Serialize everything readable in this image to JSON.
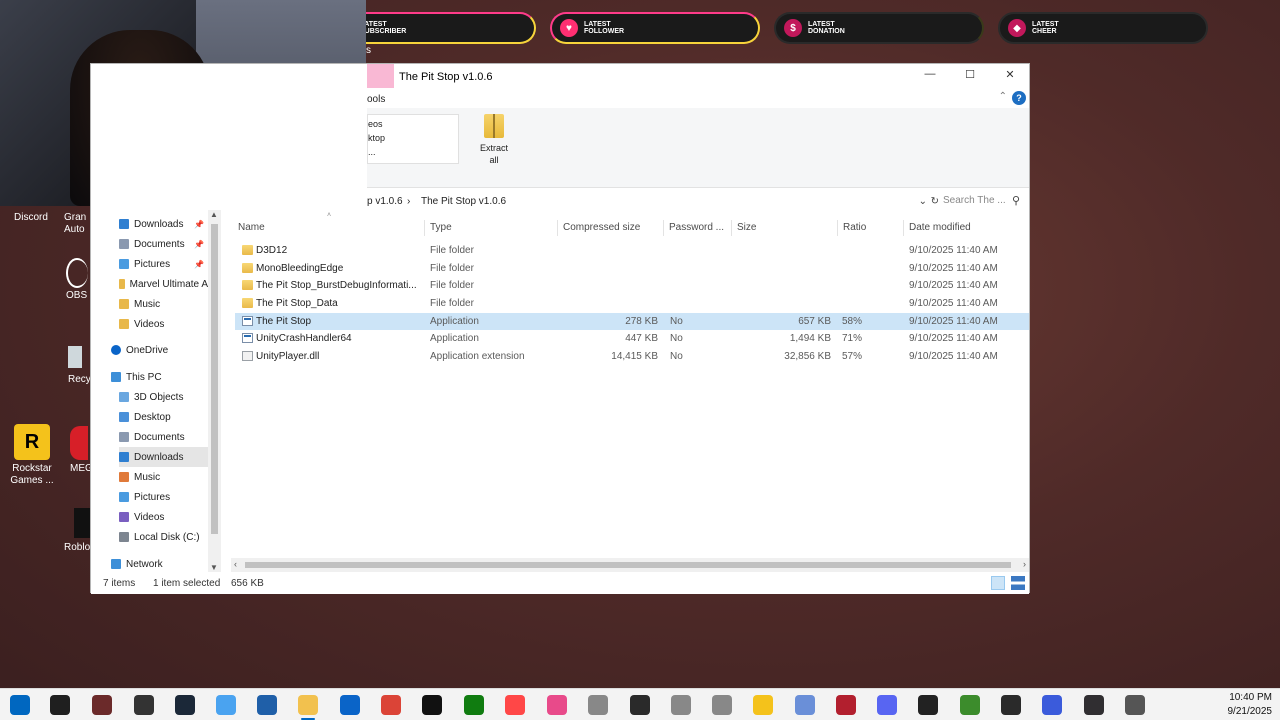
{
  "overlay": {
    "alerts": [
      {
        "line1": "LATEST",
        "line2": "SUBSCRIBER"
      },
      {
        "line1": "LATEST",
        "line2": "FOLLOWER"
      },
      {
        "line1": "LATEST",
        "line2": "DONATION"
      },
      {
        "line1": "LATEST",
        "line2": "CHEER"
      }
    ]
  },
  "desktop": {
    "icons": [
      {
        "label": "Discord"
      },
      {
        "label": "Gran Auto"
      },
      {
        "label": "OBS"
      },
      {
        "label": "Recy"
      },
      {
        "label": "Rockstar Games ..."
      },
      {
        "label": "MEG"
      },
      {
        "label": "Roblo"
      }
    ],
    "edge_text": "s"
  },
  "window": {
    "title": "The Pit Stop v1.0.6",
    "ribbon_tab": "ools",
    "ribbon_list": [
      "eos",
      "ktop",
      "..."
    ],
    "extract_label": "Extract all",
    "breadcrumb": [
      "p v1.0.6",
      "The Pit Stop v1.0.6"
    ],
    "search_placeholder": "Search The ...",
    "nav": {
      "items": [
        {
          "label": "Downloads",
          "pinned": true,
          "color": "#2f7fd1"
        },
        {
          "label": "Documents",
          "pinned": true,
          "color": "#8a99b0"
        },
        {
          "label": "Pictures",
          "pinned": true,
          "color": "#4a9be0"
        },
        {
          "label": "Marvel Ultimate A",
          "pinned": false,
          "color": "#e8b84a"
        },
        {
          "label": "Music",
          "pinned": false,
          "color": "#e8b84a"
        },
        {
          "label": "Videos",
          "pinned": false,
          "color": "#e8b84a"
        },
        {
          "label": "OneDrive",
          "pinned": false,
          "color": "#0a64c8"
        },
        {
          "label": "This PC",
          "pinned": false,
          "color": "#3d8fd8"
        },
        {
          "label": "3D Objects",
          "pinned": false,
          "color": "#6aa7e0"
        },
        {
          "label": "Desktop",
          "pinned": false,
          "color": "#4a90d9"
        },
        {
          "label": "Documents",
          "pinned": false,
          "color": "#8a99b0"
        },
        {
          "label": "Downloads",
          "pinned": false,
          "color": "#2f7fd1"
        },
        {
          "label": "Music",
          "pinned": false,
          "color": "#e07a3a"
        },
        {
          "label": "Pictures",
          "pinned": false,
          "color": "#4a9be0"
        },
        {
          "label": "Videos",
          "pinned": false,
          "color": "#7a5fc0"
        },
        {
          "label": "Local Disk (C:)",
          "pinned": false,
          "color": "#7d8590"
        },
        {
          "label": "Network",
          "pinned": false,
          "color": "#3d8fd8"
        }
      ]
    },
    "columns": [
      "Name",
      "Type",
      "Compressed size",
      "Password ...",
      "Size",
      "Ratio",
      "Date modified"
    ],
    "files": [
      {
        "name": "D3D12",
        "type": "File folder",
        "compressed": "",
        "password": "",
        "size": "",
        "ratio": "",
        "date": "9/10/2025 11:40 AM",
        "kind": "folder"
      },
      {
        "name": "MonoBleedingEdge",
        "type": "File folder",
        "compressed": "",
        "password": "",
        "size": "",
        "ratio": "",
        "date": "9/10/2025 11:40 AM",
        "kind": "folder"
      },
      {
        "name": "The Pit Stop_BurstDebugInformati...",
        "type": "File folder",
        "compressed": "",
        "password": "",
        "size": "",
        "ratio": "",
        "date": "9/10/2025 11:40 AM",
        "kind": "folder"
      },
      {
        "name": "The Pit Stop_Data",
        "type": "File folder",
        "compressed": "",
        "password": "",
        "size": "",
        "ratio": "",
        "date": "9/10/2025 11:40 AM",
        "kind": "folder"
      },
      {
        "name": "The Pit Stop",
        "type": "Application",
        "compressed": "278 KB",
        "password": "No",
        "size": "657 KB",
        "ratio": "58%",
        "date": "9/10/2025 11:40 AM",
        "kind": "app",
        "selected": true
      },
      {
        "name": "UnityCrashHandler64",
        "type": "Application",
        "compressed": "447 KB",
        "password": "No",
        "size": "1,494 KB",
        "ratio": "71%",
        "date": "9/10/2025 11:40 AM",
        "kind": "app"
      },
      {
        "name": "UnityPlayer.dll",
        "type": "Application extension",
        "compressed": "14,415 KB",
        "password": "No",
        "size": "32,856 KB",
        "ratio": "57%",
        "date": "9/10/2025 11:40 AM",
        "kind": "dll"
      }
    ],
    "status": {
      "count": "7 items",
      "selection": "1 item selected",
      "selection_size": "656 KB"
    }
  },
  "taskbar": {
    "icons": [
      {
        "name": "start-icon",
        "color": "#0067c0"
      },
      {
        "name": "search-icon",
        "color": "#1f1f1f"
      },
      {
        "name": "app-icon",
        "color": "#6b2a2a"
      },
      {
        "name": "controller-icon",
        "color": "#333333"
      },
      {
        "name": "steam-icon",
        "color": "#1b2838"
      },
      {
        "name": "copilot-icon",
        "color": "#4aa3f0"
      },
      {
        "name": "store-icon",
        "color": "#1f5fa8"
      },
      {
        "name": "file-explorer-icon",
        "color": "#f2c14e"
      },
      {
        "name": "outlook-icon",
        "color": "#0a64c8"
      },
      {
        "name": "chrome-icon",
        "color": "#db4437"
      },
      {
        "name": "capcut-icon",
        "color": "#111111"
      },
      {
        "name": "xbox-icon",
        "color": "#107c10"
      },
      {
        "name": "ea-icon",
        "color": "#ff4747"
      },
      {
        "name": "color-icon",
        "color": "#e84a8a"
      },
      {
        "name": "dot-icon",
        "color": "#888888"
      },
      {
        "name": "game-icon",
        "color": "#2a2a2a"
      },
      {
        "name": "dot2-icon",
        "color": "#888888"
      },
      {
        "name": "dot3-icon",
        "color": "#888888"
      },
      {
        "name": "rockstar-icon",
        "color": "#f4c21b"
      },
      {
        "name": "diamond-icon",
        "color": "#6a8fd8"
      },
      {
        "name": "mushroom-icon",
        "color": "#b21f2e"
      },
      {
        "name": "discord-icon",
        "color": "#5865f2"
      },
      {
        "name": "pen-icon",
        "color": "#222222"
      },
      {
        "name": "minecraft-icon",
        "color": "#3c8c2c"
      },
      {
        "name": "epic-icon",
        "color": "#2a2a2a"
      },
      {
        "name": "w-icon",
        "color": "#3b5bdb"
      },
      {
        "name": "obs-icon",
        "color": "#302e31"
      },
      {
        "name": "settings-icon",
        "color": "#555555"
      }
    ],
    "time": "10:40 PM",
    "date": "9/21/2025"
  }
}
